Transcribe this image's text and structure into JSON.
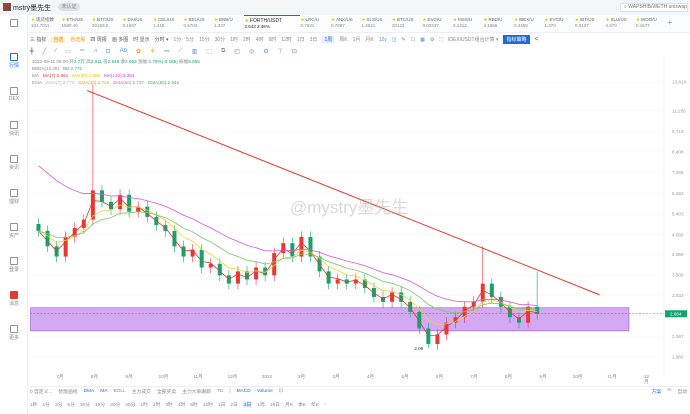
{
  "app": {
    "title": "mstry墨先生",
    "pill": "未认证",
    "search_placeholder": "WAPSHIB/WETH uniswap"
  },
  "sidebar": [
    {
      "label": "",
      "icon": "globe-icon"
    },
    {
      "label": "行情",
      "icon": "chart-icon",
      "active": true
    },
    {
      "label": "DEX",
      "icon": "swap-icon"
    },
    {
      "label": "快讯",
      "icon": "news-icon"
    },
    {
      "label": "资讯",
      "icon": "list-icon"
    },
    {
      "label": "理财",
      "icon": "wallet-icon"
    },
    {
      "label": "资产",
      "icon": "asset-icon"
    },
    {
      "label": "登录",
      "icon": "login-icon"
    },
    {
      "label": "消息",
      "icon": "message-icon"
    },
    {
      "label": "更多",
      "icon": "more-icon"
    }
  ],
  "tickers": [
    {
      "name": "现货指数",
      "value": "104.7011"
    },
    {
      "name": "ETH/US",
      "value": "1580.46"
    },
    {
      "name": "BTC/US",
      "value": "20193.2"
    },
    {
      "name": "DAI/US",
      "value": "0.1697"
    },
    {
      "name": "CEL/US",
      "value": "1.418"
    },
    {
      "name": "BEL/US",
      "value": "0.5704"
    },
    {
      "name": "BNB/U",
      "value": "1.337"
    },
    {
      "name": "FORTH/USDT",
      "value": "2.643 2.46%",
      "active": true
    },
    {
      "name": "LRC/U",
      "value": "0.7631"
    },
    {
      "name": "ANK/US",
      "value": "0.7897"
    },
    {
      "name": "SLS/US",
      "value": "1.4521"
    },
    {
      "name": "BTC/US",
      "value": "20122"
    },
    {
      "name": "EVG/U",
      "value": "0.00347"
    },
    {
      "name": "MSS/U",
      "value": "0.1312"
    },
    {
      "name": "RBD/U",
      "value": "4.1566"
    },
    {
      "name": "IBEX/U",
      "value": "0.3469"
    },
    {
      "name": "EVG/U",
      "value": "1.370"
    },
    {
      "name": "IBT/US",
      "value": "0.0127"
    },
    {
      "name": "SLU/US",
      "value": "4.970"
    },
    {
      "name": "WOO/U",
      "value": "0.1677"
    }
  ],
  "toolbar": {
    "items": [
      "三 指标",
      "自选",
      "自选股",
      "四 周报",
      "画 多图",
      "时 显示",
      "分时 ▾"
    ],
    "intervals": [
      "1分",
      "5分",
      "15分",
      "30分",
      "1时",
      "2时",
      "4时",
      "6时",
      "12时",
      "1日",
      "3日",
      "1周",
      "周K",
      "1月",
      "月K"
    ],
    "selected_interval": "1周",
    "tools": [
      "12y",
      "◫",
      "✎",
      "☐",
      "▦",
      "⚙",
      "⛶"
    ],
    "pair_select": "IDEX/USDT组合计算 ▾",
    "strategy_button": "指标策略"
  },
  "drawtools": [
    "╋",
    "╱",
    "∕",
    "▭",
    "═",
    "⩘",
    "⊡",
    "Ab",
    "✿",
    "⚘",
    "⚯",
    "⟋",
    "▥",
    "⬚",
    "⧉",
    "◰",
    "◎",
    "⚙",
    "⊤",
    "⊡"
  ],
  "ohlc": {
    "date": "2022-09-11 08:00",
    "open_label": "开",
    "open": "2.7万",
    "high_label": "高",
    "high": "2.811",
    "low_label": "低",
    "low": "2.548",
    "close_label": "收",
    "close": "2.663",
    "change_label": "涨幅",
    "change": "-1.79%(-0.185)",
    "amp_label": "振幅",
    "amp": "9.655"
  },
  "legends": [
    {
      "name": "BBDA(12,26)",
      "items": [
        {
          "text": "BB:2.772",
          "color": "#2bb673"
        }
      ]
    },
    {
      "name": "MA",
      "items": [
        {
          "text": "MA(7):2.661",
          "color": "#e53935"
        },
        {
          "text": "MA(30):2.565",
          "color": "#e6c200"
        },
        {
          "text": "MA(120):3.394",
          "color": "#d63fd6"
        }
      ]
    },
    {
      "name": "EMA",
      "items": [
        {
          "text": "EMA(7):2.773",
          "color": "#aab4c8"
        },
        {
          "text": "EMA(30):2.726",
          "color": "#e6a100"
        },
        {
          "text": "EMA(60):2.737",
          "color": "#e052b0"
        },
        {
          "text": "EMA(90):2.942",
          "color": "#3aa63a"
        }
      ]
    }
  ],
  "watermark": "@mystry墨先生",
  "chart_data": {
    "type": "candlestick",
    "symbol": "FORTH/USDT",
    "scale": "log",
    "start_date": "2021-06-12",
    "interval_days": 8,
    "closes": [
      4.8,
      4.3,
      4.0,
      4.6,
      4.9,
      5.2,
      6.4,
      5.9,
      5.6,
      6.2,
      5.5,
      5.7,
      5.3,
      5.0,
      4.8,
      4.3,
      4.0,
      4.2,
      3.7,
      3.8,
      3.5,
      3.3,
      3.6,
      3.4,
      3.7,
      3.5,
      4.1,
      4.4,
      4.0,
      4.6,
      4.0,
      3.6,
      3.3,
      3.4,
      3.3,
      3.4,
      3.2,
      3.0,
      2.9,
      3.1,
      2.9,
      2.7,
      2.4,
      2.15,
      2.3,
      2.5,
      2.6,
      2.8,
      2.9,
      3.3,
      3.0,
      2.8,
      2.6,
      2.5,
      2.8,
      2.66
    ],
    "high_overrides": {
      "6": 13.6,
      "49": 4.3,
      "55": 3.6
    },
    "low_overrides": {
      "43": 2.09
    },
    "low_label": "2.09",
    "price_ticks": [
      "13.814",
      "11.256",
      "9.716",
      "8.408",
      "7.258",
      "6.263",
      "5.403",
      "4.666",
      "4.059",
      "3.509",
      "3.033",
      "2.267",
      "1.960"
    ],
    "price_range": [
      1.96,
      13.814
    ],
    "current_price": "2.664",
    "time_ticks": [
      "7月",
      "8月",
      "9月",
      "10月",
      "11月",
      "12月",
      "2022",
      "2月",
      "3月",
      "4月",
      "5月",
      "6月",
      "7月",
      "8月",
      "9月",
      "10月",
      "11月",
      "12月"
    ],
    "time_start": "2021-07",
    "trendline": {
      "from_date": "2021-07-25",
      "from_price": 13.0,
      "to_date": "2022-10-20",
      "to_price": 3.05,
      "color": "#e53935"
    },
    "support_zone": {
      "from_date": "2021-06-05",
      "to_date": "2022-11-15",
      "low": 2.36,
      "high": 2.78,
      "color": "#c78bf0"
    },
    "averages": [
      {
        "span": 2,
        "color": "#e53935"
      },
      {
        "span": 5,
        "color": "#f0d33a"
      },
      {
        "span": 10,
        "color": "#7cc46a"
      },
      {
        "span": 16,
        "color": "#d65ad6",
        "seed": 8.0
      }
    ],
    "up_color": "#e53935",
    "down_color": "#14a36b"
  },
  "indicators": {
    "items": [
      "0 自定义...",
      "智能画线",
      "DMA",
      "MA",
      "BOLL",
      "主力成交",
      "全部买卖",
      "主力大单跟踪",
      "TD",
      "|",
      "MACD",
      "Volume",
      "⊡"
    ],
    "right": [
      "方案",
      "%",
      "自动"
    ]
  },
  "intervals_bottom": {
    "items": [
      "1秒",
      "1分",
      "3分",
      "5分",
      "10分",
      "15分",
      "30分",
      "45分",
      "1时",
      "2时",
      "3时",
      "4时",
      "6时",
      "12时",
      "1日",
      "2日",
      "3日",
      "1周",
      "15日",
      "月K",
      "季K",
      "年K",
      "›"
    ],
    "selected": "3日"
  }
}
